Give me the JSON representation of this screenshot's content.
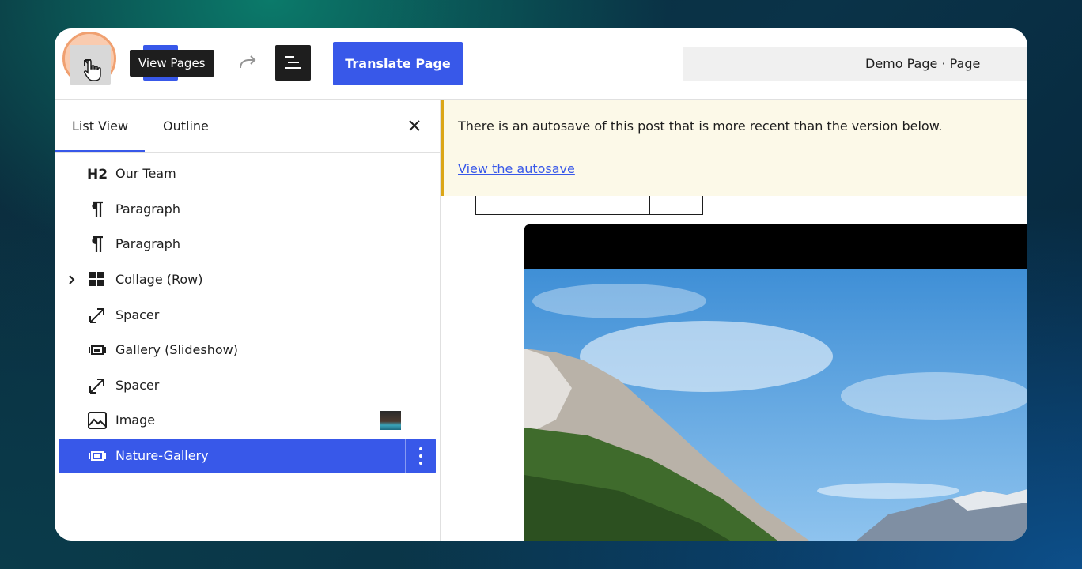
{
  "toolbar": {
    "tooltip": "View Pages",
    "translate_label": "Translate Page",
    "document_title": "Demo Page · Page"
  },
  "sidebar": {
    "tabs": [
      {
        "label": "List View",
        "active": true
      },
      {
        "label": "Outline",
        "active": false
      }
    ],
    "items": [
      {
        "label": "Our Team",
        "icon": "heading-icon"
      },
      {
        "label": "Paragraph",
        "icon": "paragraph-icon"
      },
      {
        "label": "Paragraph",
        "icon": "paragraph-icon"
      },
      {
        "label": "Collage (Row)",
        "icon": "grid-icon",
        "expandable": true
      },
      {
        "label": "Spacer",
        "icon": "resize-arrow-icon"
      },
      {
        "label": "Gallery (Slideshow)",
        "icon": "slideshow-icon"
      },
      {
        "label": "Spacer",
        "icon": "resize-arrow-icon"
      },
      {
        "label": "Image",
        "icon": "image-icon",
        "has_thumbnail": true
      },
      {
        "label": "Nature-Gallery",
        "icon": "slideshow-icon",
        "selected": true
      }
    ]
  },
  "notice": {
    "message": "There is an autosave of this post that is more recent than the version below.",
    "link": "View the autosave"
  },
  "colors": {
    "accent": "#3858e9",
    "notice_border": "#dba617",
    "notice_bg": "#fcf9e8"
  }
}
